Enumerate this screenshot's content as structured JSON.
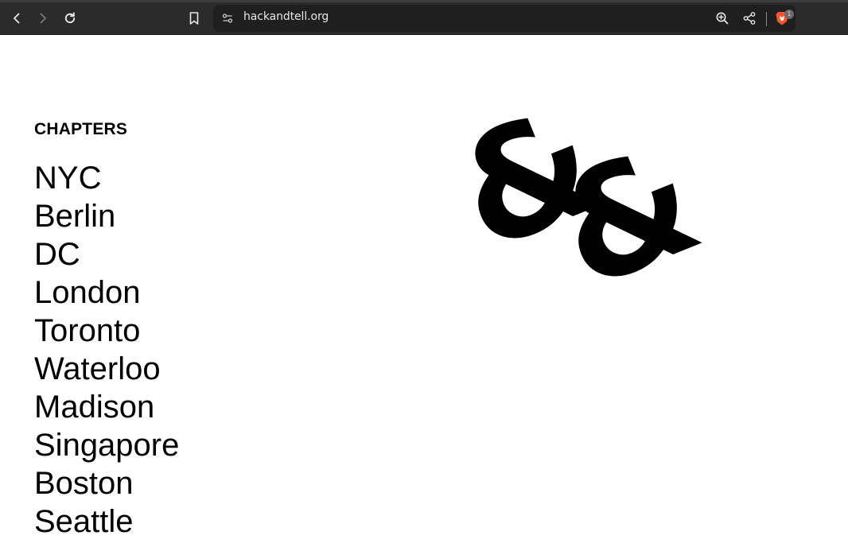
{
  "browser": {
    "url": "hackandtell.org",
    "shields_badge": "1"
  },
  "page": {
    "heading": "CHAPTERS",
    "chapters": [
      "NYC",
      "Berlin",
      "DC",
      "London",
      "Toronto",
      "Waterloo",
      "Madison",
      "Singapore",
      "Boston",
      "Seattle"
    ],
    "logo_glyph": "&"
  },
  "icons": {
    "back": "chevron-left-icon",
    "forward": "chevron-right-icon",
    "reload": "reload-icon",
    "bookmark": "bookmark-icon",
    "site_info": "site-info-icon",
    "zoom": "zoom-in-icon",
    "share": "share-icon",
    "brave": "brave-lion-icon"
  },
  "colors": {
    "toolbar_bg": "#2b2b2b",
    "urlbar_bg": "#1f1f1f",
    "page_bg": "#ffffff",
    "text": "#000000",
    "brave_orange": "#fb542b"
  }
}
